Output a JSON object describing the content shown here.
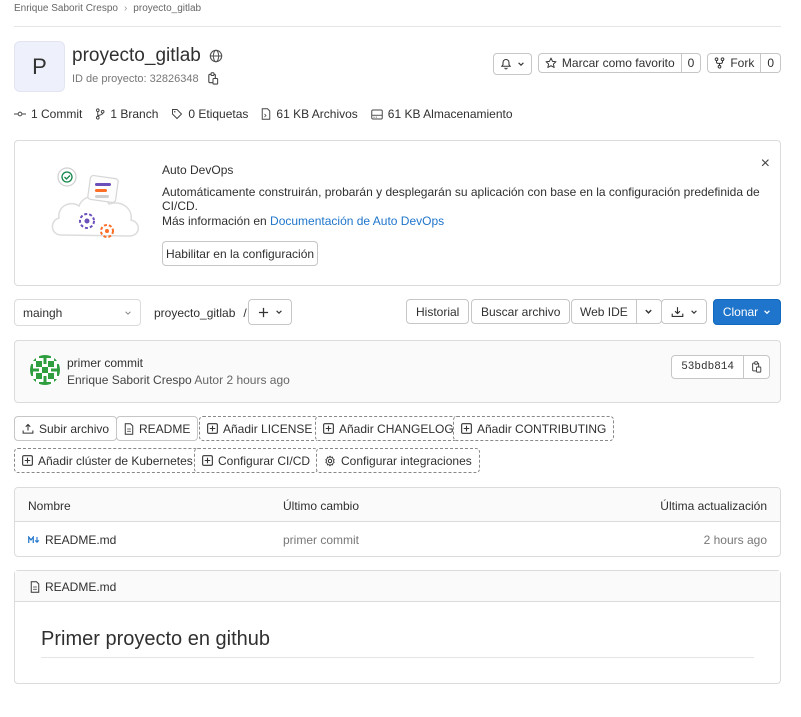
{
  "breadcrumb": {
    "user": "Enrique Saborit Crespo",
    "project": "proyecto_gitlab"
  },
  "project": {
    "avatar_letter": "P",
    "name": "proyecto_gitlab",
    "id_label": "ID de proyecto: 32826348"
  },
  "header_buttons": {
    "star_label": "Marcar como favorito",
    "star_count": "0",
    "fork_label": "Fork",
    "fork_count": "0"
  },
  "stats": {
    "commits": "1 Commit",
    "branches": "1 Branch",
    "tags": "0 Etiquetas",
    "files": "61 KB Archivos",
    "storage": "61 KB Almacenamiento"
  },
  "devops": {
    "title": "Auto DevOps",
    "description": "Automáticamente construirán, probarán y desplegarán su aplicación con base en la configuración predefinida de CI/CD.",
    "more_prefix": "Más información en ",
    "more_link": "Documentación de Auto DevOps",
    "enable_button": "Habilitar en la configuración",
    "close": "×"
  },
  "toolbar": {
    "branch": "maingh",
    "path": "proyecto_gitlab",
    "path_sep": "/",
    "history": "Historial",
    "find_file": "Buscar archivo",
    "web_ide": "Web IDE",
    "clone": "Clonar"
  },
  "commit": {
    "message": "primer commit",
    "author": "Enrique Saborit Crespo",
    "author_role": "Autor",
    "time": "2 hours ago",
    "sha": "53bdb814"
  },
  "actions": {
    "upload": "Subir archivo",
    "readme": "README",
    "license": "Añadir LICENSE",
    "changelog": "Añadir CHANGELOG",
    "contributing": "Añadir CONTRIBUTING",
    "k8s": "Añadir clúster de Kubernetes",
    "cicd": "Configurar CI/CD",
    "integrations": "Configurar integraciones"
  },
  "files_table": {
    "headers": {
      "name": "Nombre",
      "last_commit": "Último cambio",
      "last_update": "Última actualización"
    },
    "rows": [
      {
        "name": "README.md",
        "commit": "primer commit",
        "updated": "2 hours ago"
      }
    ]
  },
  "readme": {
    "filename": "README.md",
    "heading": "Primer proyecto en github"
  },
  "colors": {
    "accent": "#1f75cb",
    "link": "#1f75cb",
    "border": "#dbdbdb"
  }
}
